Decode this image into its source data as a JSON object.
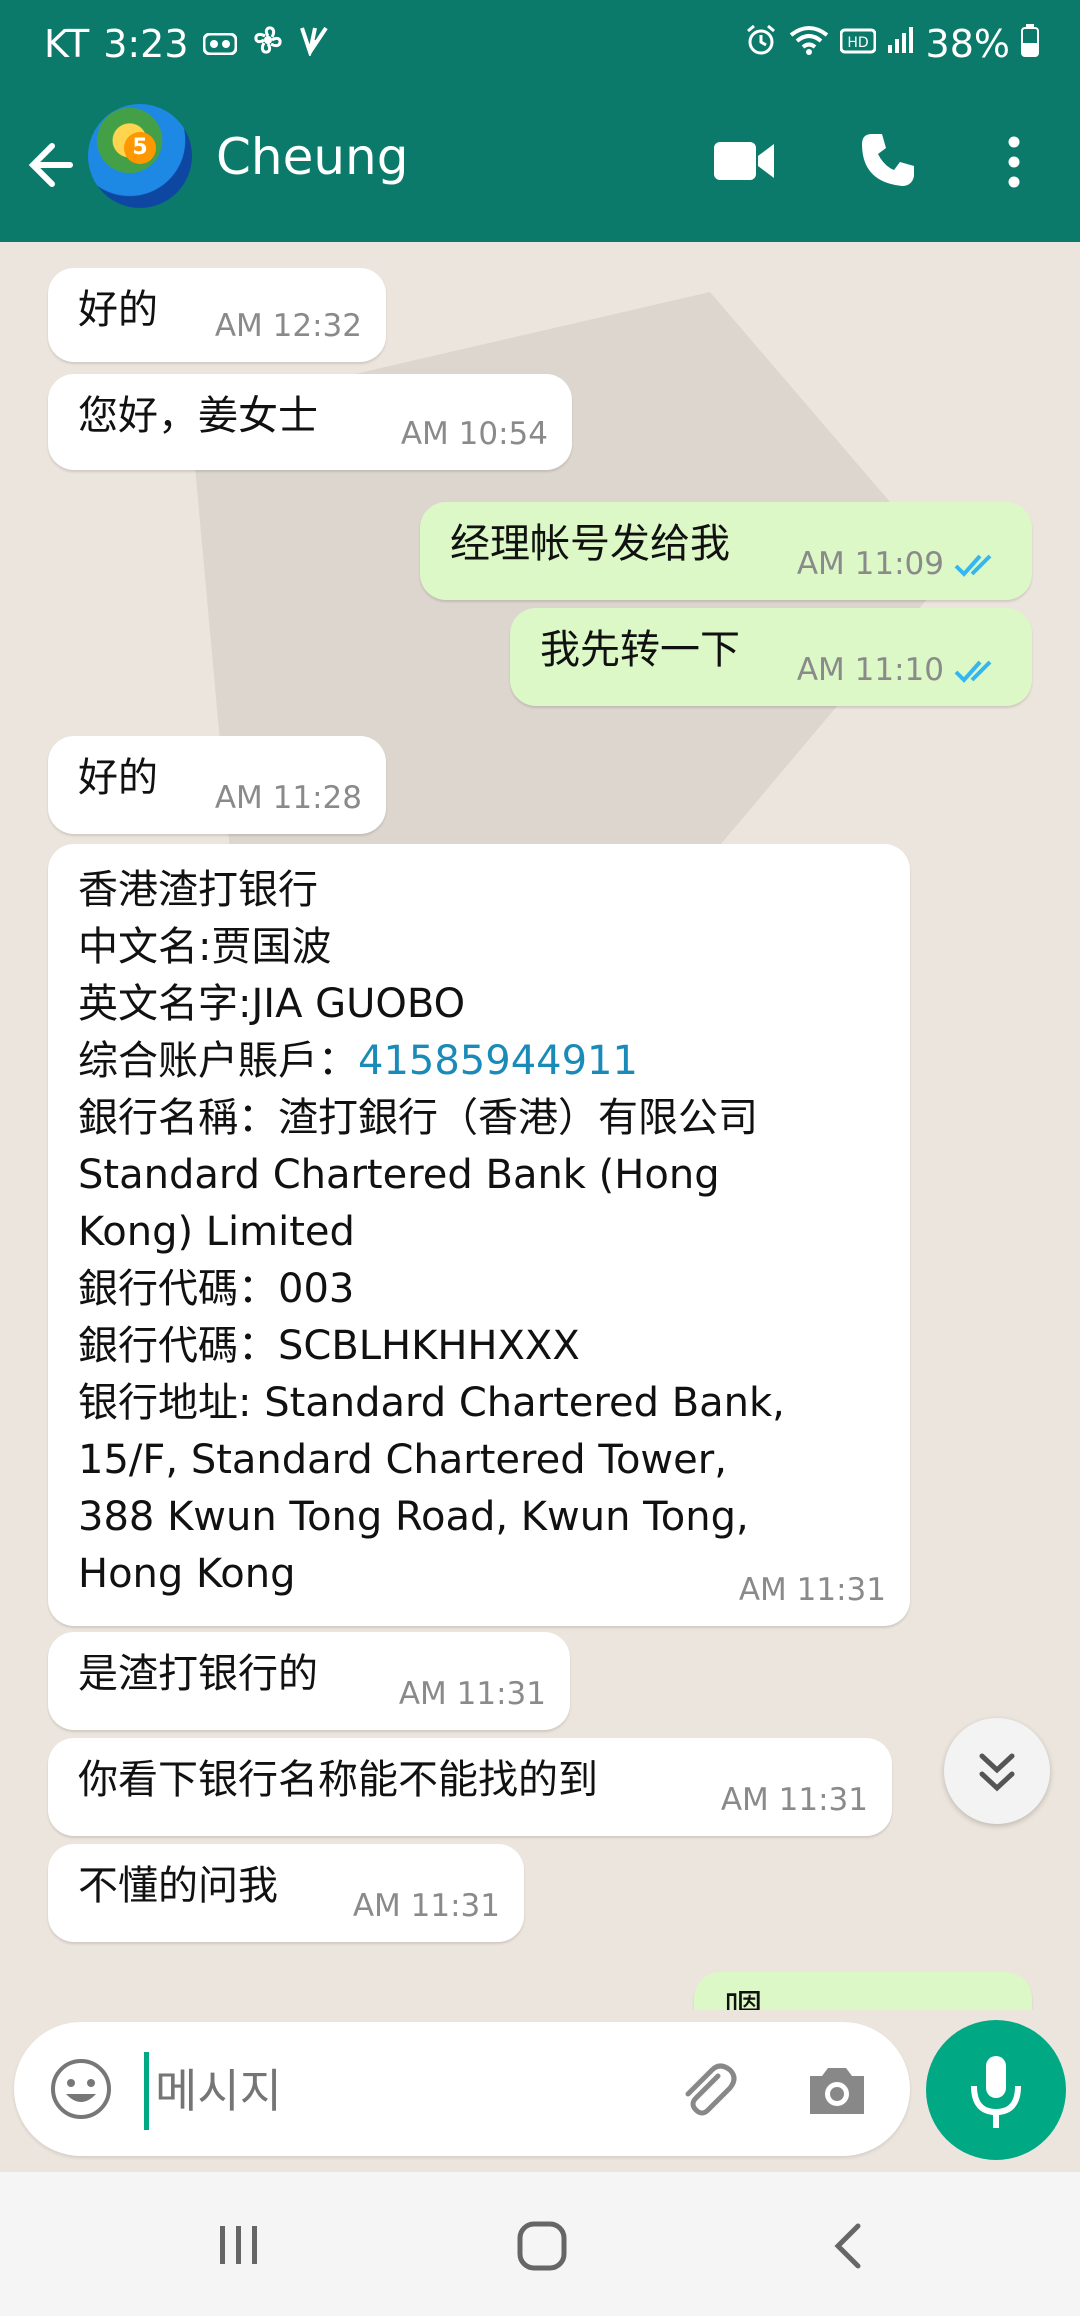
{
  "status_bar": {
    "carrier": "KT",
    "time": "3:23",
    "battery": "38%"
  },
  "header": {
    "contact_name": "Cheung",
    "avatar_badge": "5"
  },
  "messages": [
    {
      "dir": "in",
      "text": "好的",
      "time": "AM 12:32"
    },
    {
      "dir": "in",
      "text": "您好，姜女士",
      "time": "AM 10:54"
    },
    {
      "dir": "out",
      "text": "经理帐号发给我",
      "time": "AM 11:09"
    },
    {
      "dir": "out",
      "text": "我先转一下",
      "time": "AM 11:10"
    },
    {
      "dir": "in",
      "text": "好的",
      "time": "AM 11:28"
    },
    {
      "dir": "in",
      "time": "AM 11:31",
      "lines": {
        "l1": "香港渣打银行",
        "l2": "中文名:贾国波",
        "l3": "英文名字:JIA GUOBO",
        "l4_prefix": "综合账户賬戶：",
        "l4_number": "41585944911",
        "l5": "銀行名稱：渣打銀行（香港）有限公司",
        "l6": "Standard Chartered Bank (Hong",
        "l7": "Kong) Limited",
        "l8": "銀行代碼：003",
        "l9": "銀行代碼：SCBLHKHHXXX",
        "l10": "银行地址: Standard Chartered Bank,",
        "l11": "15/F, Standard Chartered Tower,",
        "l12": "388 Kwun Tong Road, Kwun Tong,",
        "l13": "Hong Kong"
      }
    },
    {
      "dir": "in",
      "text": "是渣打银行的",
      "time": "AM 11:31"
    },
    {
      "dir": "in",
      "text": "你看下银行名称能不能找的到",
      "time": "AM 11:31"
    },
    {
      "dir": "in",
      "text": "不懂的问我",
      "time": "AM 11:31"
    },
    {
      "dir": "out",
      "text": "嗯",
      "time": ""
    }
  ],
  "composer": {
    "placeholder": "메시지"
  },
  "colors": {
    "header": "#0b7a6a",
    "accent": "#00a884",
    "outgoing_bubble": "#dcf8c6",
    "incoming_bubble": "#ffffff",
    "read_ticks": "#34b7f1"
  },
  "icons": [
    "back-arrow-icon",
    "video-call-icon",
    "phone-icon",
    "more-vert-icon",
    "emoji-icon",
    "attach-icon",
    "camera-icon",
    "mic-icon",
    "chevron-double-down-icon",
    "read-ticks-icon"
  ]
}
